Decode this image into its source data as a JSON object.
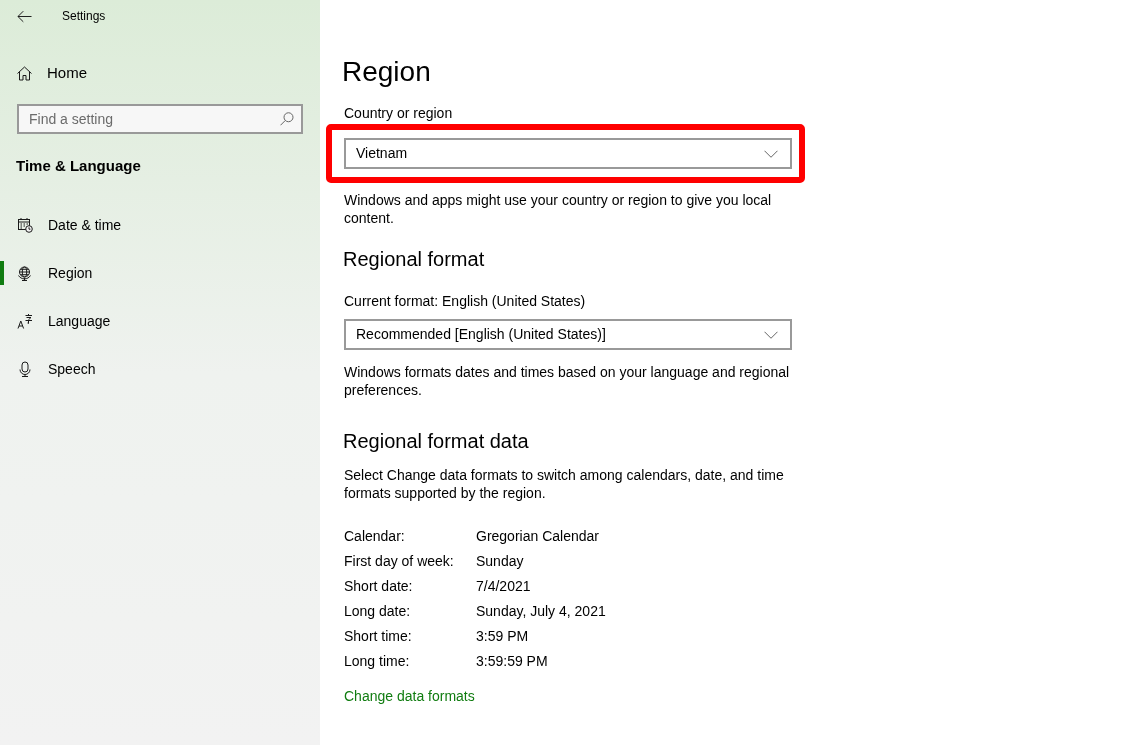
{
  "window": {
    "title": "Settings"
  },
  "sidebar": {
    "home": "Home",
    "search": {
      "placeholder": "Find a setting"
    },
    "section_title": "Time & Language",
    "items": [
      {
        "label": "Date & time",
        "selected": false
      },
      {
        "label": "Region",
        "selected": true
      },
      {
        "label": "Language",
        "selected": false
      },
      {
        "label": "Speech",
        "selected": false
      }
    ]
  },
  "page": {
    "title": "Region",
    "country": {
      "label": "Country or region",
      "value": "Vietnam",
      "highlighted": true,
      "description": "Windows and apps might use your country or region to give you local content."
    },
    "regional_format": {
      "heading": "Regional format",
      "current_format": "Current format: English (United States)",
      "value": "Recommended [English (United States)]",
      "description": "Windows formats dates and times based on your language and regional preferences."
    },
    "regional_format_data": {
      "heading": "Regional format data",
      "description": "Select Change data formats to switch among calendars, date, and time formats supported by the region.",
      "rows": [
        {
          "label": "Calendar:",
          "value": "Gregorian Calendar"
        },
        {
          "label": "First day of week:",
          "value": "Sunday"
        },
        {
          "label": "Short date:",
          "value": "7/4/2021"
        },
        {
          "label": "Long date:",
          "value": "Sunday, July 4, 2021"
        },
        {
          "label": "Short time:",
          "value": "3:59 PM"
        },
        {
          "label": "Long time:",
          "value": "3:59:59 PM"
        }
      ],
      "link": "Change data formats"
    }
  }
}
